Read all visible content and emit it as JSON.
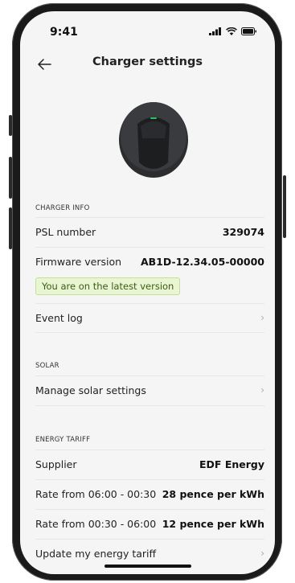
{
  "status_bar": {
    "time": "9:41"
  },
  "header": {
    "title": "Charger settings"
  },
  "charger_info": {
    "section": "CHARGER INFO",
    "psl_label": "PSL number",
    "psl_value": "329074",
    "firmware_label": "Firmware version",
    "firmware_value": "AB1D-12.34.05-00000",
    "firmware_badge": "You are on the latest version",
    "event_log_label": "Event log"
  },
  "solar": {
    "section": "SOLAR",
    "manage_label": "Manage solar settings"
  },
  "tariff": {
    "section": "ENERGY TARIFF",
    "supplier_label": "Supplier",
    "supplier_value": "EDF Energy",
    "rate1_label": "Rate from 06:00 - 00:30",
    "rate1_value": "28 pence per kWh",
    "rate2_label": "Rate from 00:30 - 06:00",
    "rate2_value": "12 pence per kWh",
    "update_label": "Update my energy tariff"
  },
  "icons": {
    "back": "arrow-left-icon",
    "chevron": "chevron-right-icon",
    "signal": "cellular-signal-icon",
    "wifi": "wifi-icon",
    "battery": "battery-icon"
  },
  "colors": {
    "badge_bg": "#eaf5d3",
    "badge_text": "#3a5b14",
    "charger_body": "#2c2d2f",
    "charger_led": "#22c55e"
  }
}
